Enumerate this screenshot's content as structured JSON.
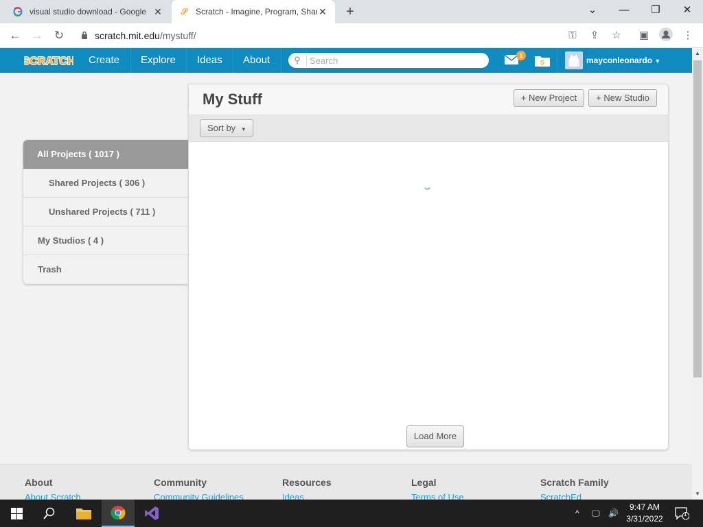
{
  "browser": {
    "tabs": [
      {
        "title": "visual studio download - Google",
        "favicon": "google-g-icon"
      },
      {
        "title": "Scratch - Imagine, Program, Shar",
        "favicon": "scratch-cat-icon"
      }
    ],
    "url_host": "scratch.mit.edu",
    "url_path": "/mystuff/"
  },
  "header": {
    "logo_text": "SCRATCH",
    "nav": [
      "Create",
      "Explore",
      "Ideas",
      "About"
    ],
    "search_placeholder": "Search",
    "message_count": "1",
    "username": "mayconleonardo"
  },
  "sidebar": {
    "items": [
      {
        "label": "All Projects ( 1017 )",
        "active": true
      },
      {
        "label": "Shared Projects ( 306 )",
        "active": false
      },
      {
        "label": "Unshared Projects ( 711 )",
        "active": false
      },
      {
        "label": "My Studios ( 4 )",
        "active": false
      },
      {
        "label": "Trash",
        "active": false
      }
    ]
  },
  "main": {
    "title": "My Stuff",
    "new_project": "+ New Project",
    "new_studio": "+ New Studio",
    "sort_by": "Sort by",
    "load_more": "Load More"
  },
  "footer": {
    "columns": [
      {
        "heading": "About",
        "link": "About Scratch"
      },
      {
        "heading": "Community",
        "link": "Community Guidelines"
      },
      {
        "heading": "Resources",
        "link": "Ideas"
      },
      {
        "heading": "Legal",
        "link": "Terms of Use"
      },
      {
        "heading": "Scratch Family",
        "link": "ScratchEd"
      }
    ]
  },
  "taskbar": {
    "time": "9:47 AM",
    "date": "3/31/2022",
    "notification_count": "1"
  },
  "colors": {
    "scratch_blue": "#0f8bc0",
    "active_sidebar": "#999999",
    "footer_link": "#1aa0d8"
  }
}
